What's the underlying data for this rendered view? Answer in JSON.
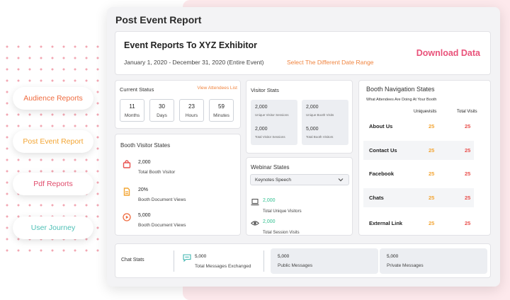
{
  "sidebar": {
    "items": [
      "Audience Reports",
      "Post Event Report",
      "Pdf Reports",
      "User Journey"
    ]
  },
  "panel": {
    "title": "Post Event Report"
  },
  "report_header": {
    "title": "Event Reports To XYZ Exhibitor",
    "date_range": "January 1, 2020 - December 31, 2020 (Entire Event)",
    "change_range_link": "Select The Different Date Range",
    "download_label": "Download Data"
  },
  "current_status": {
    "title": "Current Status",
    "link": "View Attendees List",
    "boxes": [
      {
        "value": "11",
        "unit": "Months"
      },
      {
        "value": "30",
        "unit": "Days"
      },
      {
        "value": "23",
        "unit": "Hours"
      },
      {
        "value": "59",
        "unit": "Minutes"
      }
    ]
  },
  "visitor_stats": {
    "title": "Visitor Stats",
    "tiles": [
      {
        "value_top": "2,000",
        "label_top": "Unique Visitor Sessions",
        "value_bottom": "2,000",
        "label_bottom": "Total Visitor Sessions"
      },
      {
        "value_top": "2,000",
        "label_top": "Unique Booth Visits",
        "value_bottom": "5,000",
        "label_bottom": "Total Booth Visitors"
      }
    ]
  },
  "booth_visitor": {
    "title": "Booth Visitor States",
    "rows": [
      {
        "value": "2,000",
        "label": "Total Booth Visitor"
      },
      {
        "value": "20%",
        "label": "Booth Document Views"
      },
      {
        "value": "5,000",
        "label": "Booth Document Views"
      }
    ]
  },
  "webinar": {
    "title": "Webinar States",
    "selected": "Keynotes Speech",
    "rows": [
      {
        "value": "2,000",
        "label": "Total Unique Visitors"
      },
      {
        "value": "2,000",
        "label": "Total Session Visits"
      }
    ]
  },
  "booth_nav": {
    "title": "Booth Navigation States",
    "subtitle": "What Attendees Are Doing At Your Booth",
    "col_unique": "Uniquevisits",
    "col_total": "Total Visits",
    "rows": [
      {
        "label": "About Us",
        "unique": "25",
        "total": "25"
      },
      {
        "label": "Contact Us",
        "unique": "25",
        "total": "25"
      },
      {
        "label": "Facebook",
        "unique": "25",
        "total": "25"
      },
      {
        "label": "Chats",
        "unique": "25",
        "total": "25"
      },
      {
        "label": "External Link",
        "unique": "25",
        "total": "25"
      }
    ]
  },
  "chat_stats": {
    "title": "Chat Stats",
    "total_value": "5,000",
    "total_label": "Total Messages Exchanged",
    "public_value": "5,000",
    "public_label": "Public Messages",
    "private_value": "5,000",
    "private_label": "Private Messages"
  },
  "colors": {
    "accent_orange": "#f0843f",
    "accent_pink": "#e9527a",
    "accent_yellow": "#f3a533",
    "accent_green": "#2fbf8f",
    "accent_red": "#e9524f"
  }
}
